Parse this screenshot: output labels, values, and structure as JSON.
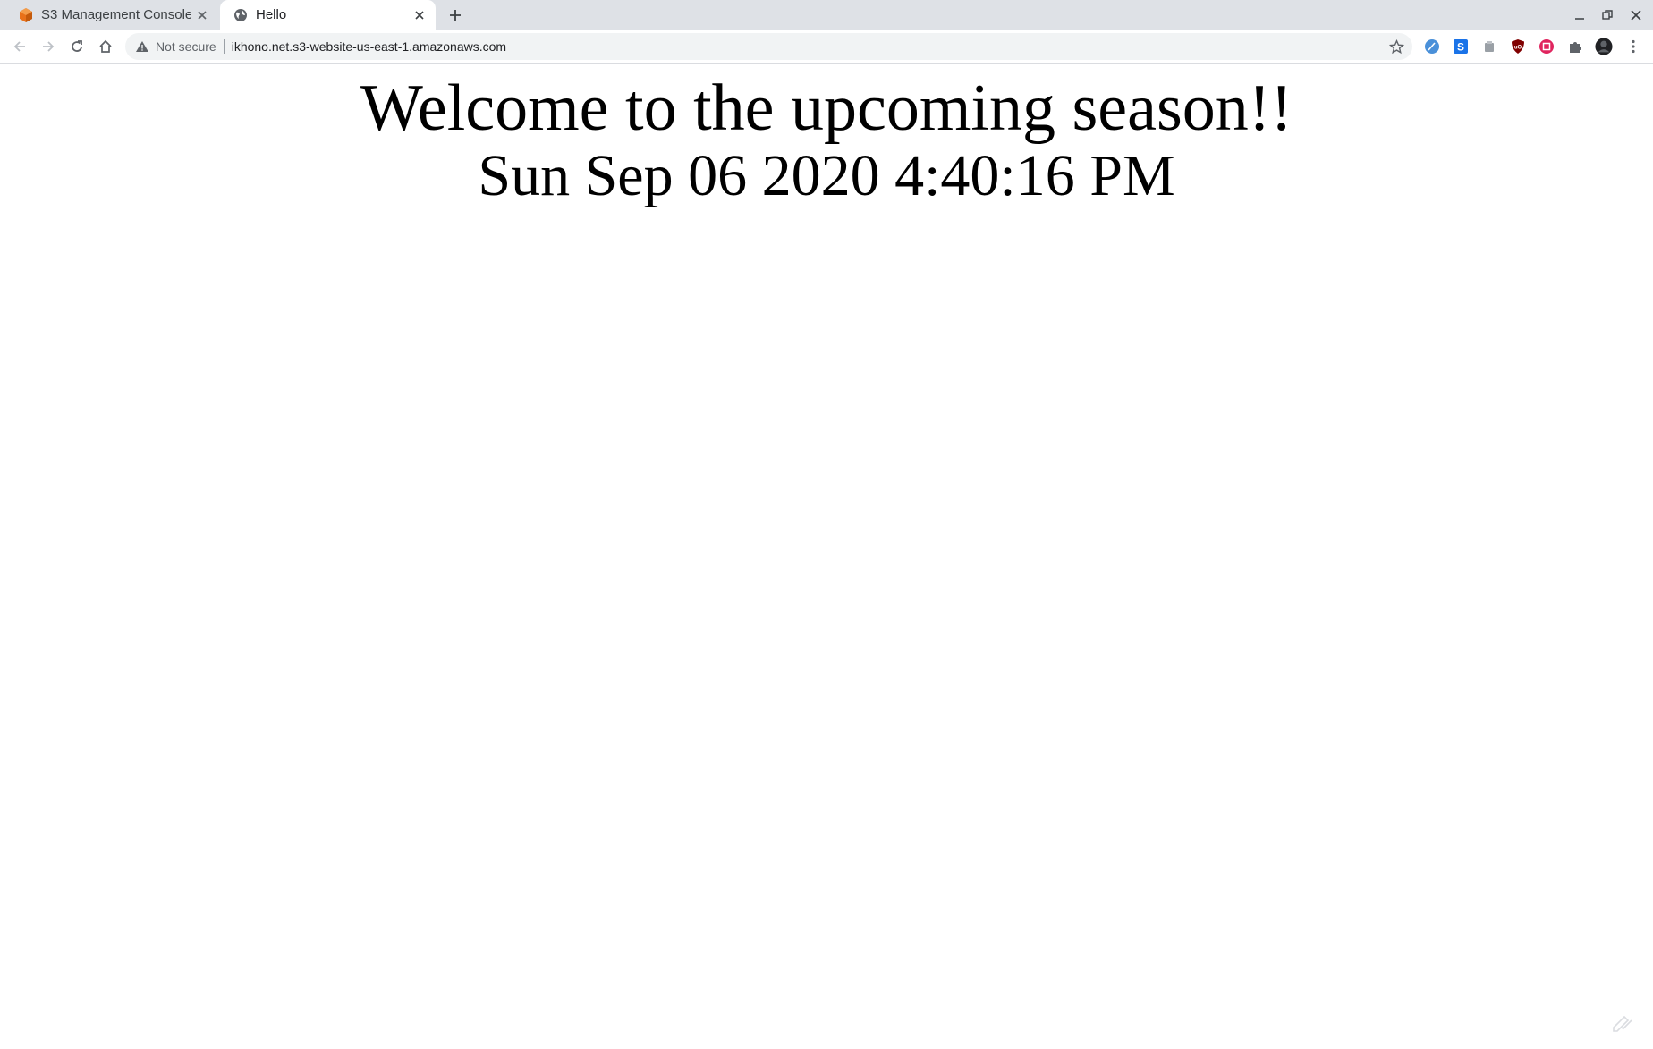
{
  "browser": {
    "tabs": [
      {
        "title": "S3 Management Console",
        "icon": "aws-cube-icon",
        "active": false
      },
      {
        "title": "Hello",
        "icon": "globe-icon",
        "active": true
      }
    ],
    "security_label": "Not secure",
    "url": "ikhono.net.s3-website-us-east-1.amazonaws.com"
  },
  "page": {
    "heading": "Welcome to the upcoming season!!",
    "datetime": "Sun Sep 06 2020 4:40:16 PM"
  },
  "colors": {
    "tabstrip": "#dee1e6",
    "omnibox": "#f1f3f4",
    "aws_orange": "#e8711a"
  }
}
